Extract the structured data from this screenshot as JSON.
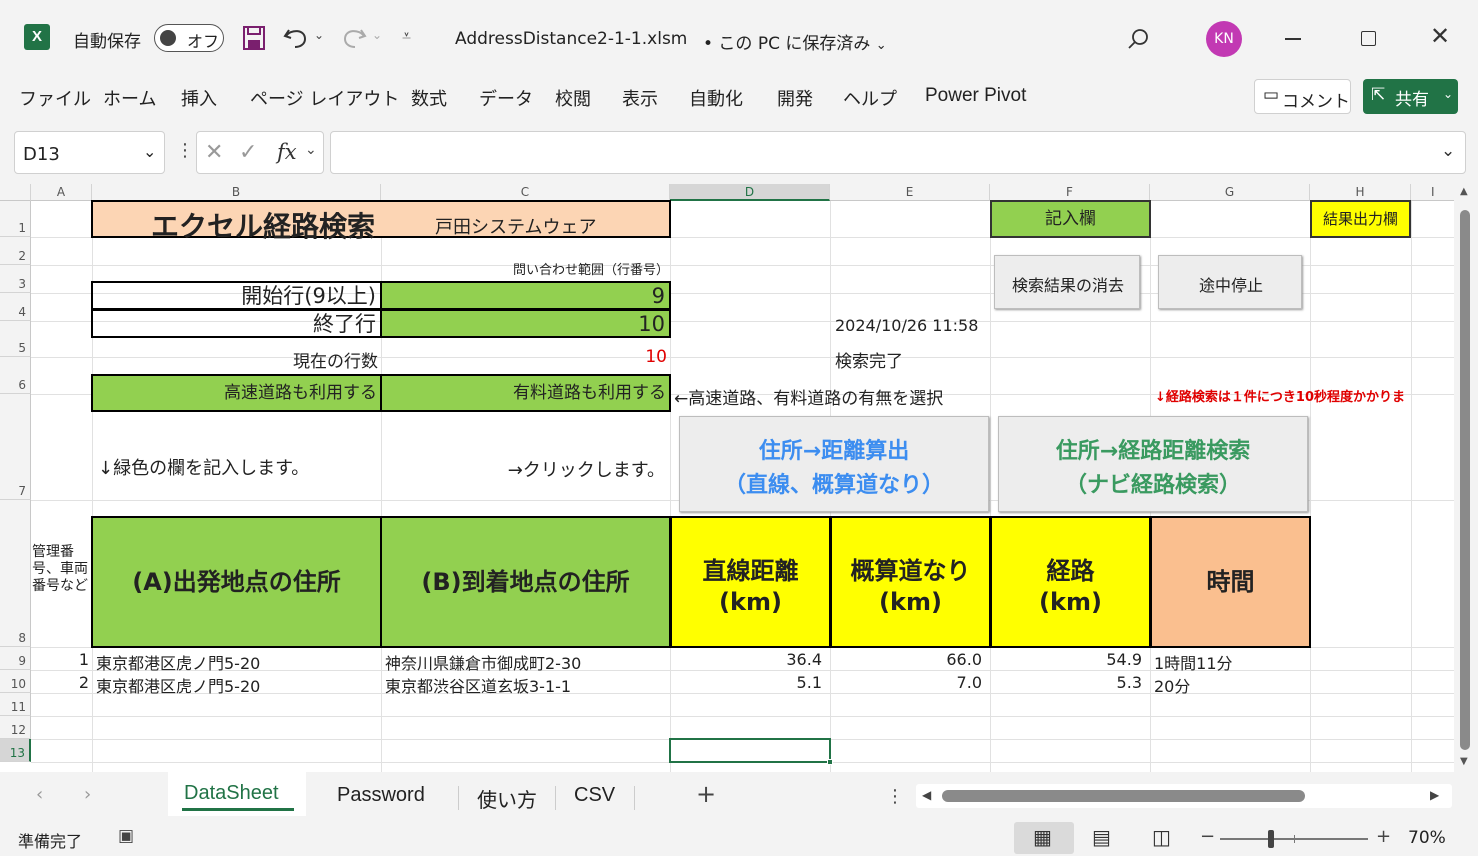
{
  "titlebar": {
    "autosave_label": "自動保存",
    "autosave_state": "オフ",
    "filename": "AddressDistance2-1-1.xlsm",
    "save_status": "• この PC に保存済み",
    "avatar_initials": "KN"
  },
  "ribbon": {
    "tabs": [
      "ファイル",
      "ホーム",
      "挿入",
      "ページ レイアウト",
      "数式",
      "データ",
      "校閲",
      "表示",
      "自動化",
      "開発",
      "ヘルプ",
      "Power Pivot"
    ],
    "comment_label": "コメント",
    "share_label": "共有"
  },
  "formula": {
    "name_box": "D13",
    "fx": "fx",
    "value": ""
  },
  "columns": [
    "A",
    "B",
    "C",
    "D",
    "E",
    "F",
    "G",
    "H",
    "I"
  ],
  "rows": [
    "1",
    "2",
    "3",
    "4",
    "5",
    "6",
    "7",
    "8",
    "9",
    "10",
    "11",
    "12",
    "13"
  ],
  "sheet": {
    "title": "エクセル経路検索",
    "company": "戸田システムウェア",
    "entry_label": "記入欄",
    "output_label": "結果出力欄",
    "range_note": "問い合わせ範囲（行番号）",
    "start_row_label": "開始行(9以上)",
    "start_row_value": "9",
    "end_row_label": "終了行",
    "end_row_value": "10",
    "timestamp": "2024/10/26 11:58",
    "current_rows_label": "現在の行数",
    "current_rows_value": "10",
    "search_status": "検索完了",
    "highway_option": "高速道路も利用する",
    "toll_option": "有料道路も利用する",
    "option_note": "←高速道路、有料道路の有無を選択",
    "warning_note": "↓経路検索は１件につき10秒程度かかりま",
    "fill_instruction": "↓緑色の欄を記入します。",
    "click_instruction": "→クリックします。",
    "btn_clear": "検索結果の消去",
    "btn_stop": "途中停止",
    "btn_distance_1": "住所→距離算出",
    "btn_distance_2": "（直線、概算道なり）",
    "btn_route_1": "住所→経路距離検索",
    "btn_route_2": "（ナビ経路検索）"
  },
  "table": {
    "header_id": "管理番号、車両番号など",
    "header_origin": "(A)出発地点の住所",
    "header_dest": "(B)到着地点の住所",
    "header_straight_1": "直線距離",
    "header_straight_2": "(km)",
    "header_approx_1": "概算道なり",
    "header_approx_2": "(km)",
    "header_route_1": "経路",
    "header_route_2": "(km)",
    "header_time": "時間",
    "rows": [
      {
        "id": "1",
        "origin": "東京都港区虎ノ門5-20",
        "dest": "神奈川県鎌倉市御成町2-30",
        "straight": "36.4",
        "approx": "66.0",
        "route": "54.9",
        "time": "1時間11分"
      },
      {
        "id": "2",
        "origin": "東京都港区虎ノ門5-20",
        "dest": "東京都渋谷区道玄坂3-1-1",
        "straight": "5.1",
        "approx": "7.0",
        "route": "5.3",
        "time": "20分"
      }
    ]
  },
  "sheets": [
    "DataSheet",
    "Password",
    "使い方",
    "CSV"
  ],
  "status": {
    "ready": "準備完了",
    "zoom": "70%"
  },
  "colors": {
    "excel_green": "#217346",
    "cell_green": "#92d050",
    "cell_yellow": "#ffff00",
    "link_blue": "#3c8df0",
    "link_green": "#3a9a60",
    "warn_red": "#e00000"
  }
}
